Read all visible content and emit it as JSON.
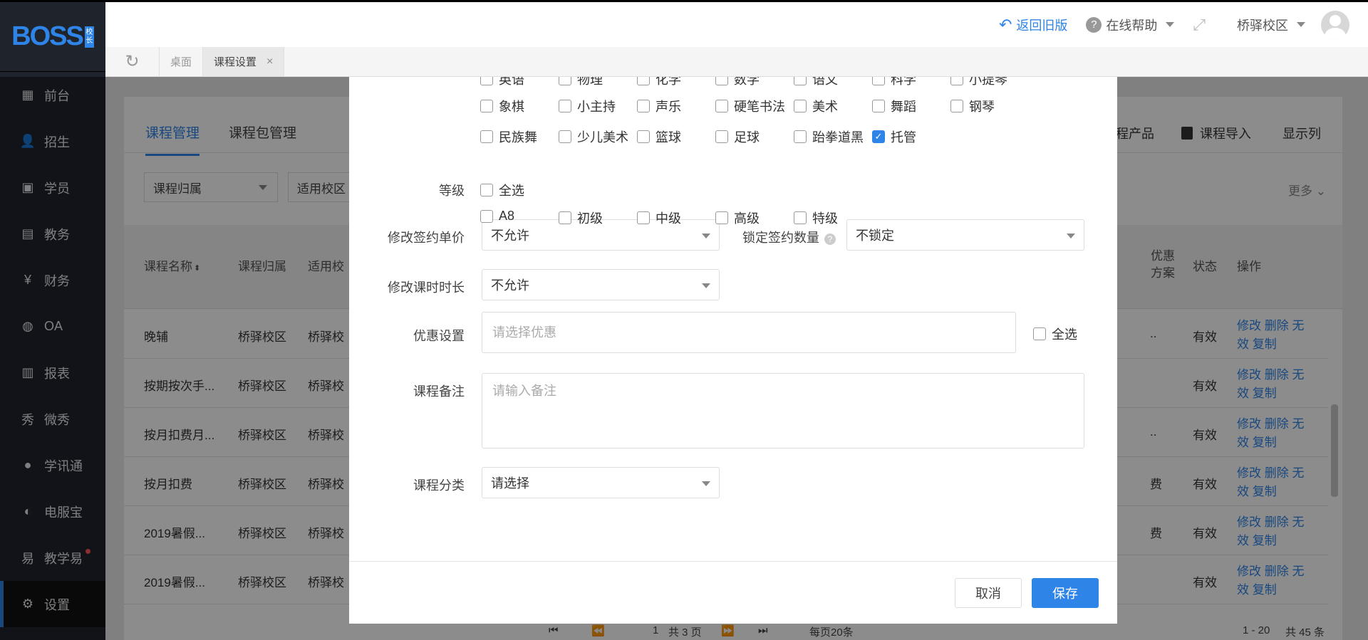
{
  "sidebar": {
    "logo_text": "BOSS",
    "logo_tag": [
      "校",
      "长"
    ],
    "items": [
      {
        "label": "前台",
        "icon": "calendar-icon"
      },
      {
        "label": "招生",
        "icon": "user-add-icon"
      },
      {
        "label": "学员",
        "icon": "student-card-icon"
      },
      {
        "label": "教务",
        "icon": "book-icon"
      },
      {
        "label": "财务",
        "icon": "yen-icon"
      },
      {
        "label": "OA",
        "icon": "chat-bubble-icon"
      },
      {
        "label": "报表",
        "icon": "bar-chart-icon"
      },
      {
        "label": "微秀",
        "icon": "xiu-icon"
      },
      {
        "label": "学讯通",
        "icon": "location-pin-icon"
      },
      {
        "label": "电服宝",
        "icon": "headset-icon"
      },
      {
        "label": "教学易",
        "icon": "teach-icon"
      },
      {
        "label": "设置",
        "icon": "gear-icon"
      }
    ],
    "active": "设置"
  },
  "topbar": {
    "back_old": "返回旧版",
    "help": "在线帮助",
    "campus": "桥驿校区"
  },
  "tabs": {
    "desktop": "桌面",
    "current": "课程设置",
    "close": "×"
  },
  "panel": {
    "tabs": [
      "课程管理",
      "课程包管理"
    ],
    "actions": [
      "程产品",
      "课程导入",
      "显示列"
    ],
    "filters": [
      "课程归属",
      "适用校区"
    ],
    "more": "更多",
    "headers": [
      "课程名称",
      "课程归属",
      "适用校",
      "优惠方案",
      "状态",
      "操作"
    ],
    "rows": [
      {
        "name": "晚辅",
        "owner": "桥驿校区",
        "campus": "桥驿校",
        "promo": "..",
        "status": "有效"
      },
      {
        "name": "按期按次手...",
        "owner": "桥驿校区",
        "campus": "桥驿校",
        "promo": "",
        "status": "有效"
      },
      {
        "name": "按月扣费月...",
        "owner": "桥驿校区",
        "campus": "桥驿校",
        "promo": "..",
        "status": "有效"
      },
      {
        "name": "按月扣费",
        "owner": "桥驿校区",
        "campus": "桥驿校",
        "promo": "费",
        "status": "有效"
      },
      {
        "name": "2019暑假...",
        "owner": "桥驿校区",
        "campus": "桥驿校",
        "promo": "费",
        "status": "有效"
      },
      {
        "name": "2019暑假...",
        "owner": "桥驿校区",
        "campus": "桥驿校",
        "promo": "",
        "status": "有效"
      }
    ],
    "row_ops": "修改 删除 无效 复制",
    "pager": {
      "page": "1",
      "total_pages": "共 3 页",
      "per_page": "每页20条",
      "range": "1 - 20",
      "total": "共 45 条"
    }
  },
  "modal": {
    "subjects_row0": [
      "英语",
      "物理",
      "化学",
      "数学",
      "语文",
      "科学",
      "小提琴"
    ],
    "subjects_row1": [
      "象棋",
      "小主持",
      "声乐",
      "硬笔书法",
      "美术",
      "舞蹈",
      "钢琴"
    ],
    "subjects_row2": [
      {
        "label": "民族舞",
        "checked": false
      },
      {
        "label": "少儿美术",
        "checked": false
      },
      {
        "label": "篮球",
        "checked": false
      },
      {
        "label": "足球",
        "checked": false
      },
      {
        "label": "跆拳道黑",
        "checked": false
      },
      {
        "label": "托管",
        "checked": true
      }
    ],
    "level_label": "等级",
    "select_all": "全选",
    "levels": [
      "A8",
      "初级",
      "中级",
      "高级",
      "特级"
    ],
    "modify_price_label": "修改签约单价",
    "modify_price_value": "不允许",
    "lock_qty_label": "锁定签约数量",
    "lock_qty_value": "不锁定",
    "modify_duration_label": "修改课时时长",
    "modify_duration_value": "不允许",
    "promo_label": "优惠设置",
    "promo_placeholder": "请选择优惠",
    "promo_select_all": "全选",
    "remark_label": "课程备注",
    "remark_placeholder": "请输入备注",
    "category_label": "课程分类",
    "category_value": "请选择",
    "cancel": "取消",
    "save": "保存"
  }
}
